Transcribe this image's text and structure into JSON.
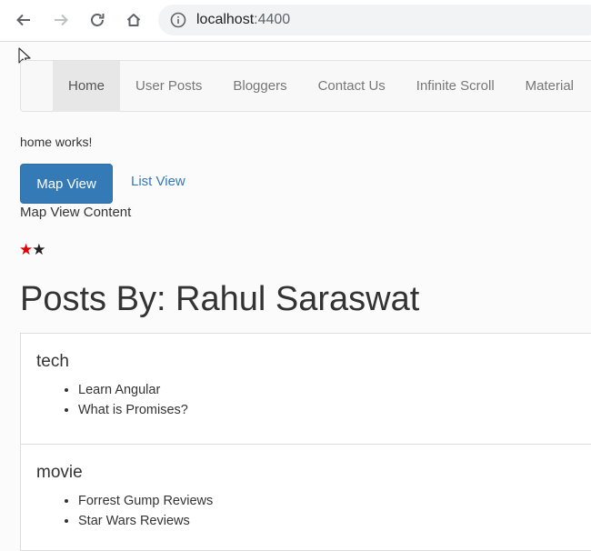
{
  "browser": {
    "url_host": "localhost",
    "url_port": ":4400",
    "icons": [
      "back-arrow-icon",
      "forward-arrow-icon",
      "reload-icon",
      "home-icon",
      "info-icon",
      "mouse-cursor-icon"
    ]
  },
  "navbar": {
    "items": [
      {
        "label": "Home",
        "active": true
      },
      {
        "label": "User Posts",
        "active": false
      },
      {
        "label": "Bloggers",
        "active": false
      },
      {
        "label": "Contact Us",
        "active": false
      },
      {
        "label": "Infinite Scroll",
        "active": false
      },
      {
        "label": "Material",
        "active": false
      }
    ]
  },
  "home": {
    "status_text": "home works!",
    "view_buttons": {
      "map": "Map View",
      "list": "List View"
    },
    "map_content": "Map View Content",
    "rating": {
      "filled": 1,
      "total": 2,
      "glyph": "★",
      "colors": {
        "filled": "#e00000",
        "empty": "#222222"
      }
    }
  },
  "posts": {
    "title": "Posts By: Rahul Saraswat",
    "categories": [
      {
        "name": "tech",
        "items": [
          "Learn Angular",
          "What is Promises?"
        ]
      },
      {
        "name": "movie",
        "items": [
          "Forrest Gump Reviews",
          "Star Wars Reviews"
        ]
      }
    ]
  },
  "colors": {
    "primary": "#337ab7",
    "link": "#337ab7",
    "nav_active_bg": "#e7e7e7"
  }
}
